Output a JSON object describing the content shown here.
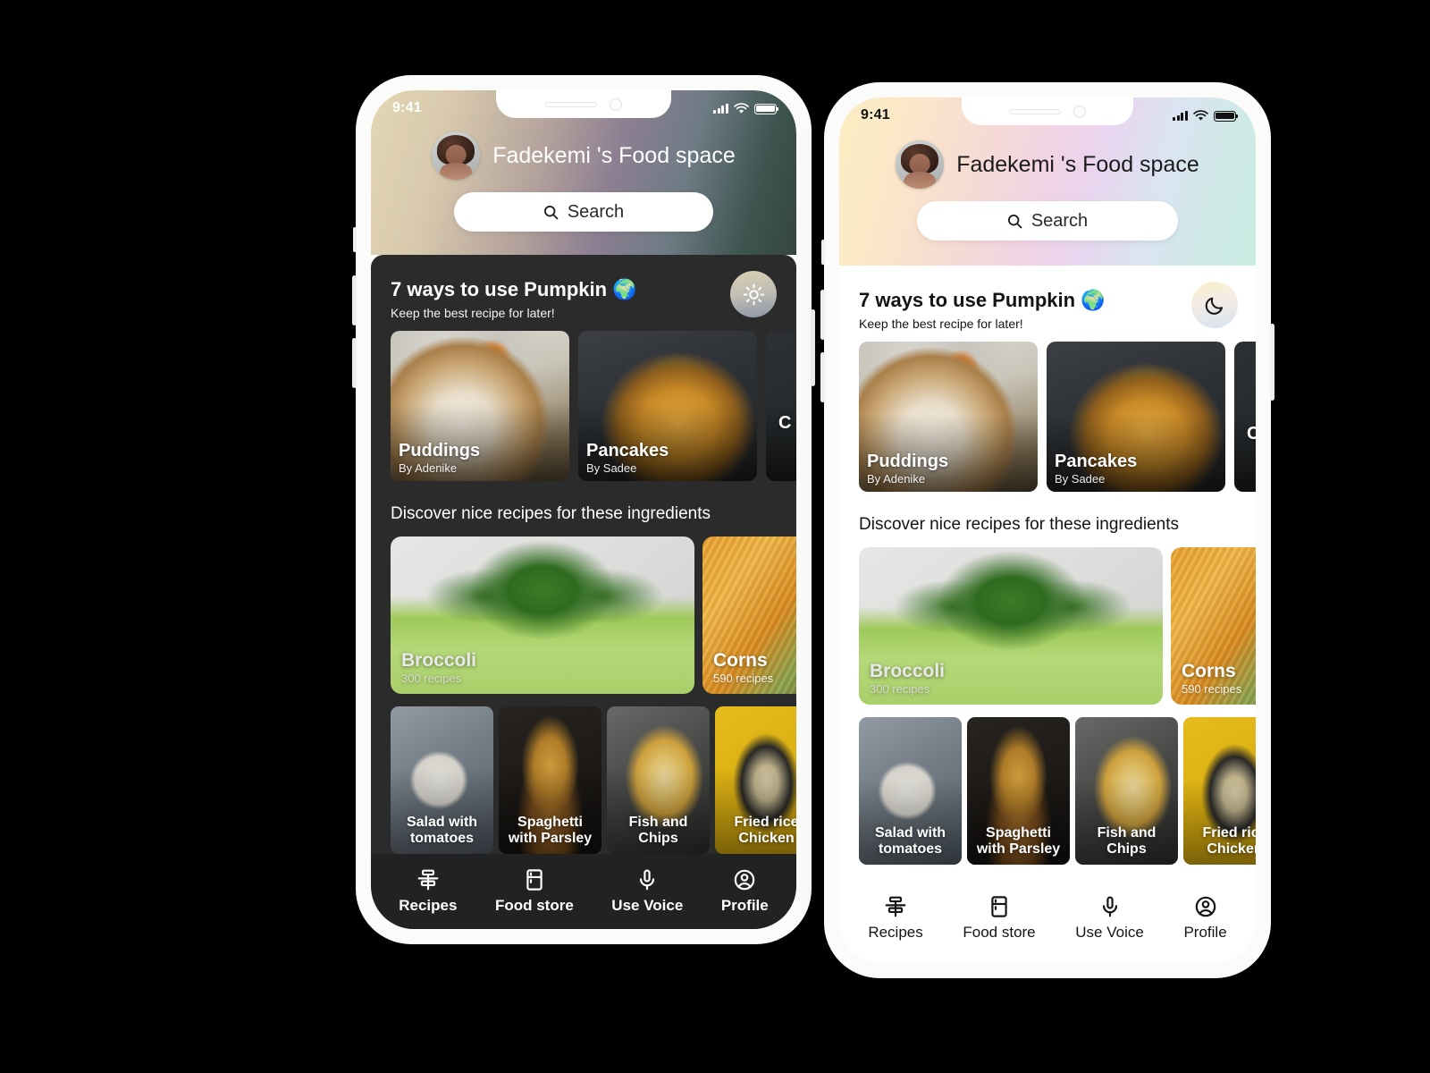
{
  "canvas": {
    "background": "#000000"
  },
  "phones": [
    {
      "id": "dark",
      "theme_name": "dark-mode",
      "status": {
        "time": "9:41"
      },
      "header": {
        "title": "Fadekemi 's Food space",
        "avatar_name": "user-avatar",
        "gradient": "linear-gradient(105deg,#e3d7b4 0%, #d8c9ad 18%, #b3a29c 40%, #8d7f92 56%, #6e7b84 72%, #3e5550 88%, #34463f 100%)"
      },
      "search": {
        "placeholder": "Search",
        "icon": "search-icon"
      },
      "sheet": {
        "background": "#2b2b2b",
        "text_color": "#ffffff"
      },
      "mode_toggle": {
        "icon": "sun-icon",
        "label": "Switch to light mode"
      },
      "section_recipes": {
        "title": "7 ways to use Pumpkin 🌍",
        "subtitle": "Keep the best recipe  for later!"
      },
      "recipe_cards": [
        {
          "title": "Puddings",
          "author": "By Adenike",
          "image": "img-pudding"
        },
        {
          "title": "Pancakes",
          "author": "By Sadee",
          "image": "img-pancake"
        },
        {
          "title": "C",
          "author": "",
          "image": "img-dark3"
        }
      ],
      "section_ingredients": {
        "title": "Discover nice recipes for these ingredients"
      },
      "ingredient_cards": [
        {
          "name": "Broccoli",
          "count": "300 recipes",
          "image": "img-broccoli"
        },
        {
          "name": "Corns",
          "count": "590 recipes",
          "image": "img-corn"
        }
      ],
      "dish_cards": [
        {
          "title": "Salad with tomatoes",
          "image": "img-salad"
        },
        {
          "title": "Spaghetti with Parsley",
          "image": "img-spaghetti"
        },
        {
          "title": "Fish and Chips",
          "image": "img-fishchips"
        },
        {
          "title": "Fried rice Chicken",
          "image": "img-friedrice"
        }
      ],
      "tabs": [
        {
          "label": "Recipes",
          "icon": "recipes-icon"
        },
        {
          "label": "Food store",
          "icon": "fridge-icon"
        },
        {
          "label": "Use Voice",
          "icon": "microphone-icon"
        },
        {
          "label": "Profile",
          "icon": "profile-icon"
        }
      ],
      "tabbar": {
        "background": "#222222",
        "text_color": "#ffffff"
      }
    },
    {
      "id": "light",
      "theme_name": "light-mode",
      "status": {
        "time": "9:41"
      },
      "header": {
        "title": "Fadekemi 's Food space",
        "avatar_name": "user-avatar",
        "gradient": "linear-gradient(105deg,#fbeec3 0%, #fbe7c8 16%, #f7dcd3 32%, #f2d3e3 48%, #e9d5ef 60%, #dbe4f2 74%, #cfeae6 88%, #c9ece2 100%)"
      },
      "search": {
        "placeholder": "Search",
        "icon": "search-icon"
      },
      "sheet": {
        "background": "#ffffff",
        "text_color": "#141414"
      },
      "mode_toggle": {
        "icon": "moon-icon",
        "label": "Switch to dark mode"
      },
      "section_recipes": {
        "title": "7 ways to use Pumpkin 🌍",
        "subtitle": "Keep the best recipe  for later!"
      },
      "recipe_cards": [
        {
          "title": "Puddings",
          "author": "By Adenike",
          "image": "img-pudding"
        },
        {
          "title": "Pancakes",
          "author": "By Sadee",
          "image": "img-pancake"
        },
        {
          "title": "C",
          "author": "",
          "image": "img-dark3"
        }
      ],
      "section_ingredients": {
        "title": "Discover nice recipes for these ingredients"
      },
      "ingredient_cards": [
        {
          "name": "Broccoli",
          "count": "300 recipes",
          "image": "img-broccoli"
        },
        {
          "name": "Corns",
          "count": "590 recipes",
          "image": "img-corn"
        }
      ],
      "dish_cards": [
        {
          "title": "Salad with tomatoes",
          "image": "img-salad"
        },
        {
          "title": "Spaghetti with Parsley",
          "image": "img-spaghetti"
        },
        {
          "title": "Fish and Chips",
          "image": "img-fishchips"
        },
        {
          "title": "Fried rice Chicken",
          "image": "img-friedrice"
        }
      ],
      "tabs": [
        {
          "label": "Recipes",
          "icon": "recipes-icon"
        },
        {
          "label": "Food store",
          "icon": "fridge-icon"
        },
        {
          "label": "Use Voice",
          "icon": "microphone-icon"
        },
        {
          "label": "Profile",
          "icon": "profile-icon"
        }
      ],
      "tabbar": {
        "background": "#ffffff",
        "text_color": "#141414"
      }
    }
  ]
}
